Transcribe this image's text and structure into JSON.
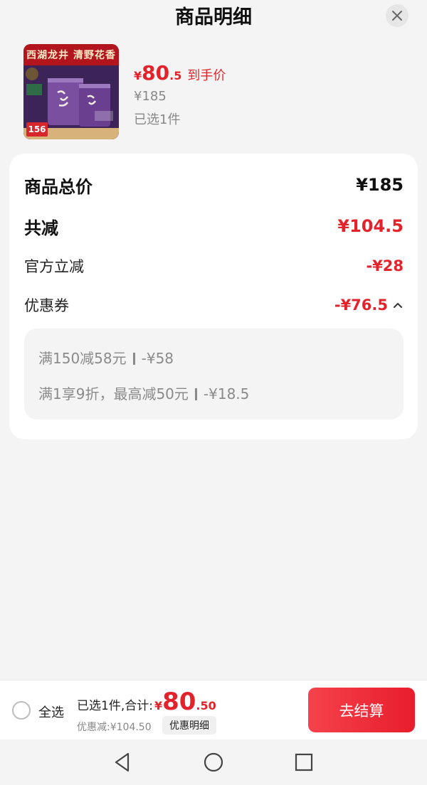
{
  "header": {
    "title": "商品明细",
    "close_icon": "close-icon"
  },
  "product": {
    "thumb_banner": "西湖龙井 清野花香",
    "thumb_tag": "156",
    "price_symbol": "¥",
    "price_int": "80",
    "price_dec": ".5",
    "price_tag": "到手价",
    "original_price": "¥185",
    "selected": "已选1件"
  },
  "detail": {
    "total_label": "商品总价",
    "total_value": "¥185",
    "reduce_label": "共减",
    "reduce_value": "¥104.5",
    "official_label": "官方立减",
    "official_value": "-¥28",
    "coupon_label": "优惠券",
    "coupon_value": "-¥76.5",
    "coupon_lines": [
      {
        "rule": "满150减58元",
        "amount": "-¥58"
      },
      {
        "rule": "满1享9折，最高减50元",
        "amount": "-¥18.5"
      }
    ]
  },
  "bottom": {
    "select_all": "全选",
    "summary": "已选1件,合计:",
    "sum_symbol": "¥",
    "sum_int": "80",
    "sum_dec": ".50",
    "discount": "优惠减:¥104.50",
    "detail_button": "优惠明细",
    "checkout": "去结算"
  },
  "colors": {
    "accent": "#e2232b",
    "background": "#f4f4f4"
  }
}
